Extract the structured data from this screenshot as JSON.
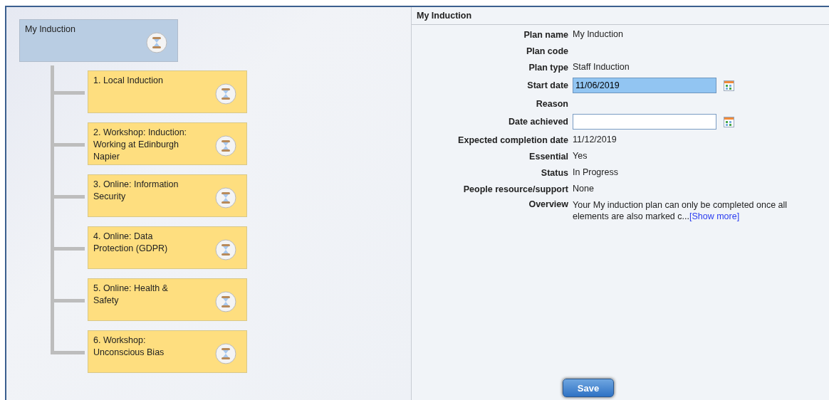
{
  "tree": {
    "title": "My Induction",
    "children": [
      {
        "title": "1. Local Induction"
      },
      {
        "title": "2. Workshop: Induction: Working at Edinburgh Napier"
      },
      {
        "title": "3. Online: Information Security"
      },
      {
        "title": "4. Online: Data Protection (GDPR)"
      },
      {
        "title": "5. Online: Health & Safety"
      },
      {
        "title": "6. Workshop: Unconscious Bias"
      }
    ]
  },
  "details": {
    "title": "My Induction",
    "fields": [
      {
        "kind": "text",
        "label": "Plan name",
        "value": "My Induction"
      },
      {
        "kind": "text",
        "label": "Plan code"
      },
      {
        "kind": "text",
        "label": "Plan type",
        "value": "Staff Induction"
      },
      {
        "kind": "date",
        "label": "Start date",
        "value": "11/06/2019",
        "highlighted": true
      },
      {
        "kind": "text",
        "label": "Reason"
      },
      {
        "kind": "date",
        "label": "Date achieved",
        "highlighted": false
      },
      {
        "kind": "text",
        "label": "Expected completion date",
        "value": "11/12/2019"
      },
      {
        "kind": "text",
        "label": "Essential",
        "value": "Yes"
      },
      {
        "kind": "text",
        "label": "Status",
        "value": "In Progress"
      },
      {
        "kind": "text",
        "label": "People resource/support",
        "value": "None"
      },
      {
        "kind": "overview",
        "label": "Overview",
        "value": "Your My induction plan can only be completed once all elements are also marked c...",
        "link": "[Show more]"
      }
    ]
  },
  "save_button": "Save"
}
